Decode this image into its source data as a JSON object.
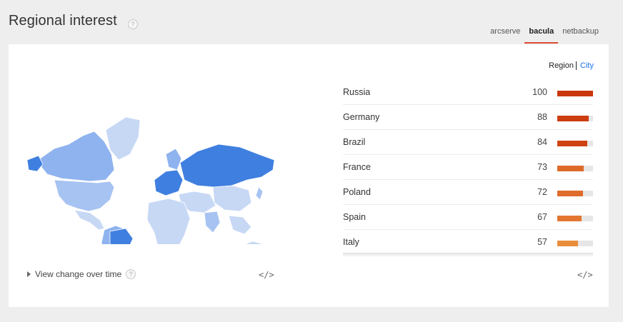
{
  "header": {
    "title": "Regional interest",
    "help": "?"
  },
  "tabs": [
    {
      "label": "arcserve",
      "active": false
    },
    {
      "label": "bacula",
      "active": true
    },
    {
      "label": "netbackup",
      "active": false
    }
  ],
  "region_switch": {
    "selected": "Region",
    "other": "City"
  },
  "rankings": [
    {
      "name": "Russia",
      "value": 100,
      "color": "#c9380c"
    },
    {
      "name": "Germany",
      "value": 88,
      "color": "#cc3d10"
    },
    {
      "name": "Brazil",
      "value": 84,
      "color": "#cf4313"
    },
    {
      "name": "France",
      "value": 73,
      "color": "#de6a2a"
    },
    {
      "name": "Poland",
      "value": 72,
      "color": "#df6c2b"
    },
    {
      "name": "Spain",
      "value": 67,
      "color": "#e27630"
    },
    {
      "name": "Italy",
      "value": 57,
      "color": "#e98d3c"
    }
  ],
  "footer": {
    "view_change": "View change over time",
    "help": "?",
    "embed": "</>"
  },
  "colors": {
    "accent": "#dd4b39",
    "map_strong": "#3f7fe0",
    "map_mid": "#8fb3ef",
    "map_light": "#c7d8f5"
  }
}
